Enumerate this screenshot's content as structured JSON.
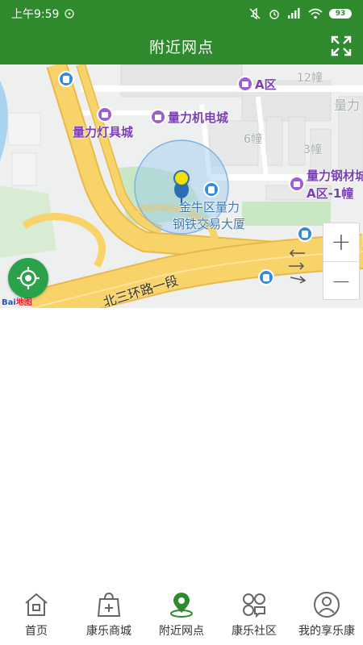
{
  "status_bar": {
    "time": "上午9:59",
    "battery": "93"
  },
  "header": {
    "title": "附近网点",
    "fullscreen_icon": "expand-icon"
  },
  "map": {
    "pois": [
      {
        "name": "A区",
        "kind": "poi"
      },
      {
        "name": "量力机电城",
        "kind": "poi"
      },
      {
        "name": "量力灯具城",
        "kind": "poi"
      },
      {
        "name": "量力钢材城",
        "kind": "poi"
      },
      {
        "name": "A区-1幢",
        "kind": "poi"
      }
    ],
    "building_labels": [
      "12幢",
      "6幢",
      "3幢",
      "量力"
    ],
    "main_building": [
      "金牛区量力",
      "钢铁交易大厦"
    ],
    "road_name": "北三环路一段",
    "attribution": "Bai",
    "attribution_suffix": "地图",
    "zoom_in": "+",
    "zoom_out": "−",
    "colors": {
      "road": "#f7d36a",
      "road_edge": "#e9b948",
      "green": "#c9e7c4",
      "water": "#a9d3f0",
      "marker": "#f2e000"
    }
  },
  "tabs": [
    {
      "label": "首页",
      "icon": "home-icon"
    },
    {
      "label": "康乐商城",
      "icon": "shopping-bag-icon"
    },
    {
      "label": "附近网点",
      "icon": "location-pin-icon",
      "active": true
    },
    {
      "label": "康乐社区",
      "icon": "community-grid-icon"
    },
    {
      "label": "我的享乐康",
      "icon": "user-profile-icon"
    }
  ],
  "theme": {
    "primary": "#2e8a2c",
    "accent": "#2aa24a"
  }
}
